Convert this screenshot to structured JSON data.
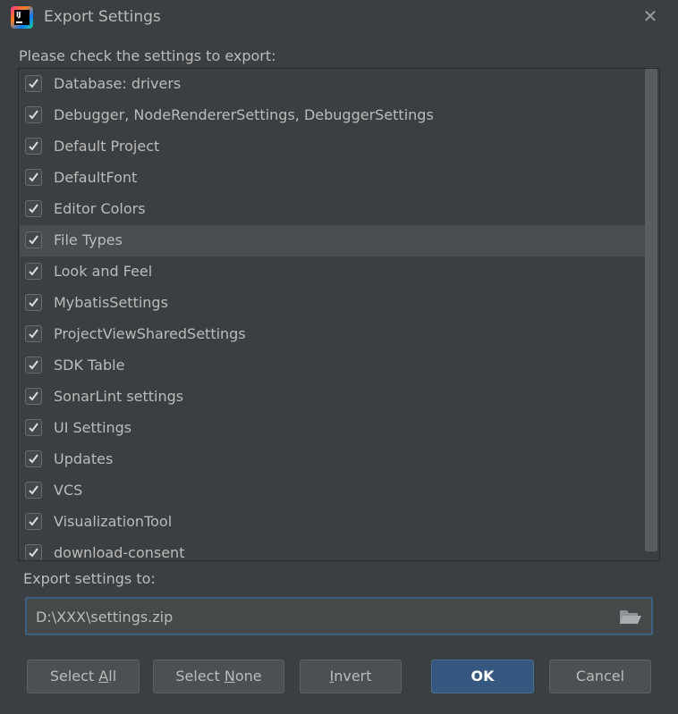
{
  "window": {
    "title": "Export Settings",
    "close_glyph": "✕",
    "logo_text": "IJ"
  },
  "prompt": "Please check the settings to export:",
  "items": [
    {
      "label": "Database: drivers",
      "checked": true
    },
    {
      "label": "Debugger, NodeRendererSettings, DebuggerSettings",
      "checked": true
    },
    {
      "label": "Default Project",
      "checked": true
    },
    {
      "label": "DefaultFont",
      "checked": true
    },
    {
      "label": "Editor Colors",
      "checked": true
    },
    {
      "label": "File Types",
      "checked": true,
      "selected": true
    },
    {
      "label": "Look and Feel",
      "checked": true
    },
    {
      "label": "MybatisSettings",
      "checked": true
    },
    {
      "label": "ProjectViewSharedSettings",
      "checked": true
    },
    {
      "label": "SDK Table",
      "checked": true
    },
    {
      "label": "SonarLint settings",
      "checked": true
    },
    {
      "label": "UI Settings",
      "checked": true
    },
    {
      "label": "Updates",
      "checked": true
    },
    {
      "label": "VCS",
      "checked": true
    },
    {
      "label": "VisualizationTool",
      "checked": true
    },
    {
      "label": "download-consent",
      "checked": true
    }
  ],
  "export": {
    "label": "Export settings to:",
    "path_value": "D:\\XXX\\settings.zip",
    "folder_icon": "folder-open-icon"
  },
  "buttons": {
    "select_all": {
      "pre": "Select ",
      "mnemonic": "A",
      "post": "ll"
    },
    "select_none": {
      "pre": "Select ",
      "mnemonic": "N",
      "post": "one"
    },
    "invert": {
      "pre": "",
      "mnemonic": "I",
      "post": "nvert"
    },
    "ok": "OK",
    "cancel": "Cancel"
  },
  "colors": {
    "background": "#3c3f41",
    "selection": "#4a4d50",
    "accent": "#365880",
    "focus_border": "#3d6185",
    "text": "#bbbbbb"
  }
}
